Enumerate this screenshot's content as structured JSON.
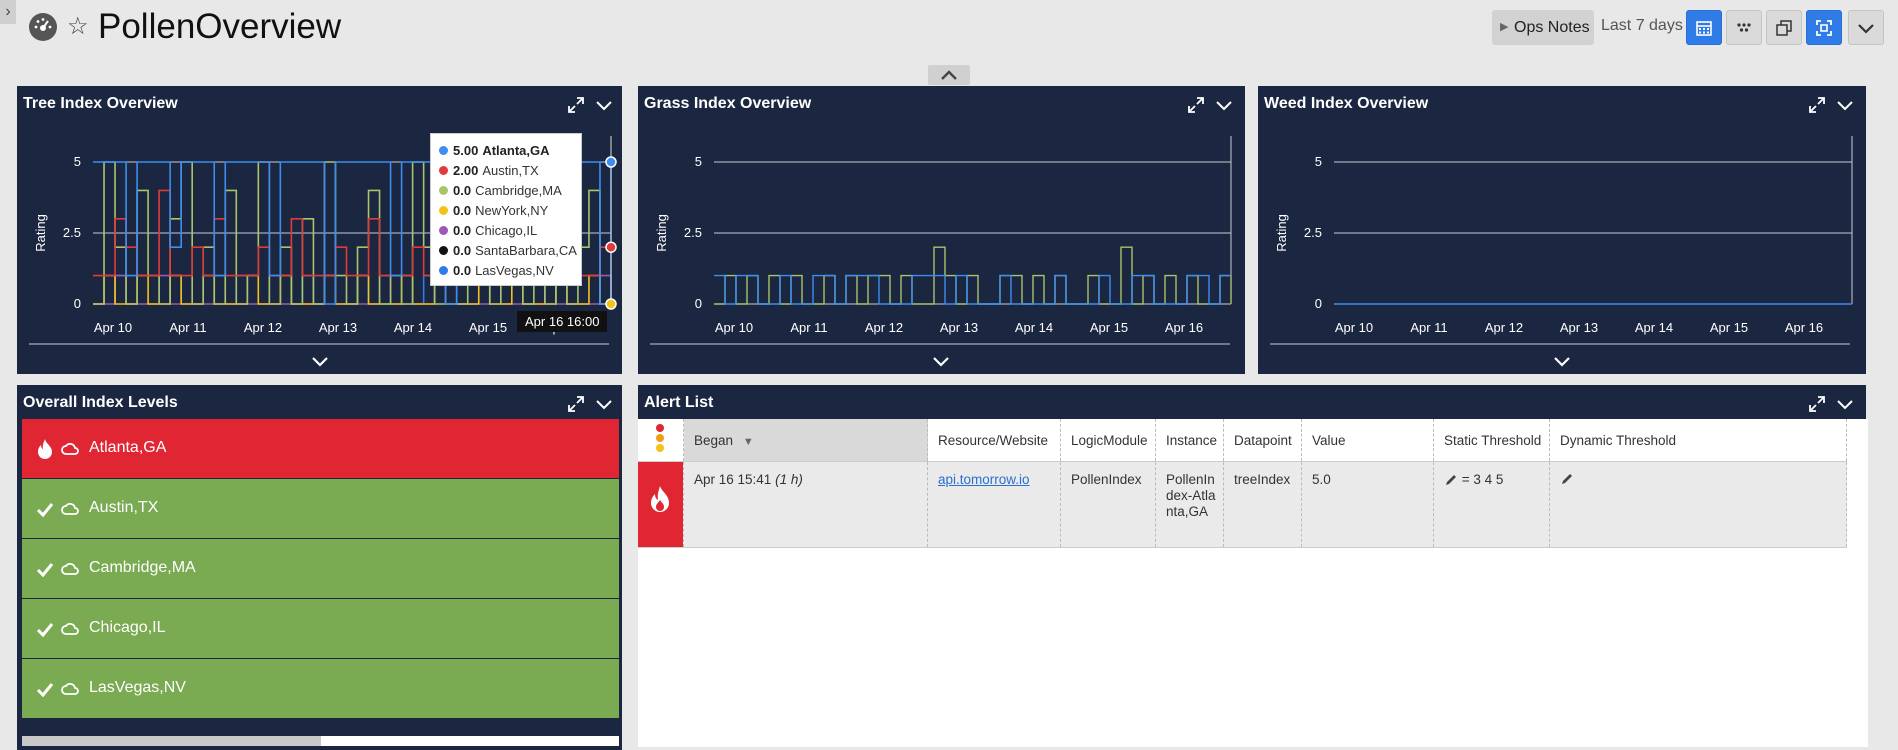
{
  "header": {
    "title": "PollenOverview",
    "ops_notes_label": "Ops Notes",
    "time_range": "Last 7 days"
  },
  "colors": {
    "panel_bg": "#1b2640",
    "critical": "#e02633",
    "ok": "#7aaa52",
    "accent": "#2f7be8"
  },
  "panels": {
    "tree": {
      "title": "Tree Index Overview",
      "ylabel": "Rating"
    },
    "grass": {
      "title": "Grass Index Overview",
      "ylabel": "Rating"
    },
    "weed": {
      "title": "Weed Index Overview",
      "ylabel": "Rating"
    },
    "levels": {
      "title": "Overall Index Levels"
    },
    "alerts": {
      "title": "Alert List"
    }
  },
  "chart_data": [
    {
      "type": "line",
      "title": "Tree Index Overview",
      "ylabel": "Rating",
      "yticks": [
        "5",
        "2.5",
        "0"
      ],
      "xticks": [
        "Apr 10",
        "Apr 11",
        "Apr 12",
        "Apr 13",
        "Apr 14",
        "Apr 15",
        "Apr 16"
      ],
      "ylim": [
        0,
        5
      ],
      "series": [
        {
          "name": "Atlanta,GA",
          "color": "#3d8ef0",
          "values": [
            5,
            5,
            5,
            1,
            5,
            5,
            5,
            2,
            5,
            5,
            5,
            1,
            5,
            5,
            5,
            5,
            1,
            5,
            5,
            5,
            5,
            0,
            5,
            5,
            5,
            5,
            5,
            1,
            5,
            5,
            5,
            5,
            0,
            5,
            5,
            5,
            5,
            1,
            5,
            5,
            1,
            5,
            5,
            5,
            5,
            5,
            0,
            5
          ]
        },
        {
          "name": "Austin,TX",
          "color": "#e03b3b",
          "values": [
            1,
            1,
            3,
            2,
            1,
            1,
            4,
            1,
            1,
            2,
            1,
            3,
            1,
            1,
            1,
            2,
            1,
            1,
            3,
            1,
            1,
            1,
            2,
            1,
            1,
            3,
            1,
            1,
            1,
            2,
            1,
            1,
            1,
            2,
            1,
            1,
            3,
            1,
            1,
            1,
            2,
            1,
            1,
            2,
            1,
            1,
            2,
            2
          ]
        },
        {
          "name": "Cambridge,MA",
          "color": "#a9c46a",
          "values": [
            0,
            5,
            2,
            0,
            4,
            1,
            0,
            3,
            5,
            0,
            2,
            0,
            4,
            0,
            1,
            5,
            0,
            2,
            0,
            3,
            0,
            5,
            1,
            0,
            2,
            4,
            0,
            1,
            0,
            5,
            2,
            0,
            3,
            0,
            1,
            4,
            0,
            2,
            5,
            0,
            1,
            0,
            3,
            0,
            2,
            4,
            0,
            0
          ]
        },
        {
          "name": "NewYork,NY",
          "color": "#f3c21b",
          "values": [
            0,
            1,
            0,
            0,
            1,
            0,
            0,
            1,
            0,
            0,
            1,
            0,
            0,
            0,
            1,
            0,
            0,
            1,
            0,
            0,
            0,
            1,
            0,
            0,
            1,
            0,
            0,
            0,
            1,
            0,
            0,
            1,
            0,
            0,
            0,
            1,
            0,
            0,
            1,
            0,
            0,
            0,
            1,
            0,
            0,
            1,
            0,
            0
          ]
        },
        {
          "name": "Chicago,IL",
          "color": "#9b59b6",
          "values": [
            0,
            0,
            1,
            0,
            0,
            0,
            1,
            0,
            0,
            0,
            0,
            1,
            0,
            0,
            0,
            0,
            1,
            0,
            0,
            0,
            0,
            1,
            0,
            0,
            0,
            0,
            1,
            0,
            0,
            0,
            0,
            1,
            0,
            0,
            0,
            0,
            1,
            0,
            0,
            0,
            0,
            1,
            0,
            0,
            0,
            0,
            1,
            0
          ]
        },
        {
          "name": "SantaBarbara,CA",
          "color": "#111111",
          "values": [
            0,
            0,
            0,
            0,
            0,
            0,
            0,
            0,
            0,
            0,
            0,
            0,
            0,
            0,
            0,
            0,
            0,
            0,
            0,
            0,
            0,
            0,
            0,
            0,
            0,
            0,
            0,
            0,
            0,
            0,
            0,
            0,
            0,
            0,
            0,
            0,
            0,
            0,
            0,
            0,
            0,
            0,
            0,
            0,
            0,
            0,
            0,
            0
          ]
        },
        {
          "name": "LasVegas,NV",
          "color": "#2f7be8",
          "values": [
            0,
            0,
            1,
            0,
            0,
            0,
            0,
            1,
            0,
            0,
            0,
            0,
            0,
            1,
            0,
            0,
            0,
            0,
            0,
            1,
            0,
            0,
            0,
            0,
            1,
            0,
            0,
            0,
            0,
            0,
            1,
            0,
            0,
            0,
            0,
            0,
            1,
            0,
            0,
            0,
            0,
            1,
            0,
            0,
            0,
            0,
            0,
            0
          ]
        }
      ]
    },
    {
      "type": "line",
      "title": "Grass Index Overview",
      "ylabel": "Rating",
      "yticks": [
        "5",
        "2.5",
        "0"
      ],
      "xticks": [
        "Apr 10",
        "Apr 11",
        "Apr 12",
        "Apr 13",
        "Apr 14",
        "Apr 15",
        "Apr 16"
      ],
      "ylim": [
        0,
        5
      ],
      "series": [
        {
          "name": "Atlanta,GA",
          "color": "#3d8ef0",
          "values": [
            1,
            0,
            1,
            1,
            0,
            0,
            1,
            0,
            0,
            1,
            1,
            0,
            1,
            1,
            1,
            0,
            0,
            0,
            1,
            1,
            1,
            0,
            1,
            0,
            0,
            0,
            1,
            0,
            0,
            0,
            0,
            1,
            0,
            0,
            0,
            1,
            0,
            0,
            1,
            1,
            0,
            0,
            0,
            1,
            1,
            0,
            1,
            1
          ]
        },
        {
          "name": "Cambridge,MA",
          "color": "#a9c46a",
          "values": [
            0,
            1,
            0,
            1,
            0,
            1,
            0,
            1,
            0,
            0,
            1,
            0,
            1,
            0,
            1,
            1,
            0,
            1,
            0,
            0,
            2,
            1,
            0,
            1,
            0,
            0,
            1,
            1,
            0,
            1,
            0,
            1,
            0,
            0,
            1,
            0,
            0,
            2,
            0,
            1,
            0,
            1,
            0,
            1,
            0,
            0,
            1,
            0
          ]
        }
      ]
    },
    {
      "type": "line",
      "title": "Weed Index Overview",
      "ylabel": "Rating",
      "yticks": [
        "5",
        "2.5",
        "0"
      ],
      "xticks": [
        "Apr 10",
        "Apr 11",
        "Apr 12",
        "Apr 13",
        "Apr 14",
        "Apr 15",
        "Apr 16"
      ],
      "ylim": [
        0,
        5
      ],
      "series": [
        {
          "name": "Atlanta,GA",
          "color": "#3d8ef0",
          "values": [
            0,
            0,
            0,
            0,
            0,
            0,
            0,
            0,
            0,
            0,
            0,
            0,
            0,
            0,
            0,
            0,
            0,
            0,
            0,
            0,
            0,
            0,
            0,
            0,
            0,
            0,
            0,
            0,
            0,
            0,
            0,
            0,
            0,
            0,
            0,
            0,
            0,
            0,
            0,
            0,
            0,
            0,
            0,
            0,
            0,
            0,
            0,
            0
          ]
        }
      ]
    }
  ],
  "tooltip": {
    "time": "Apr 16 16:00",
    "rows": [
      {
        "value": "5.00",
        "name": "Atlanta,GA",
        "color": "#3d8ef0"
      },
      {
        "value": "2.00",
        "name": "Austin,TX",
        "color": "#e03b3b"
      },
      {
        "value": "0.0",
        "name": "Cambridge,MA",
        "color": "#a9c46a"
      },
      {
        "value": "0.0",
        "name": "NewYork,NY",
        "color": "#f3c21b"
      },
      {
        "value": "0.0",
        "name": "Chicago,IL",
        "color": "#9b59b6"
      },
      {
        "value": "0.0",
        "name": "SantaBarbara,CA",
        "color": "#111111"
      },
      {
        "value": "0.0",
        "name": "LasVegas,NV",
        "color": "#2f7be8"
      }
    ]
  },
  "levels": [
    {
      "name": "Atlanta,GA",
      "status": "critical"
    },
    {
      "name": "Austin,TX",
      "status": "ok"
    },
    {
      "name": "Cambridge,MA",
      "status": "ok"
    },
    {
      "name": "Chicago,IL",
      "status": "ok"
    },
    {
      "name": "LasVegas,NV",
      "status": "ok"
    }
  ],
  "alerts": {
    "columns": [
      "Began",
      "Resource/Website",
      "LogicModule",
      "Instance",
      "Datapoint",
      "Value",
      "Static Threshold",
      "Dynamic Threshold"
    ],
    "rows": [
      {
        "began": "Apr 16 15:41",
        "duration": "(1 h)",
        "resource": "api.tomorrow.io",
        "logic_module": "PollenIndex",
        "instance": "PollenIndex-Atlanta,GA",
        "datapoint": "treeIndex",
        "value": "5.0",
        "static_threshold": "= 3 4 5"
      }
    ]
  }
}
